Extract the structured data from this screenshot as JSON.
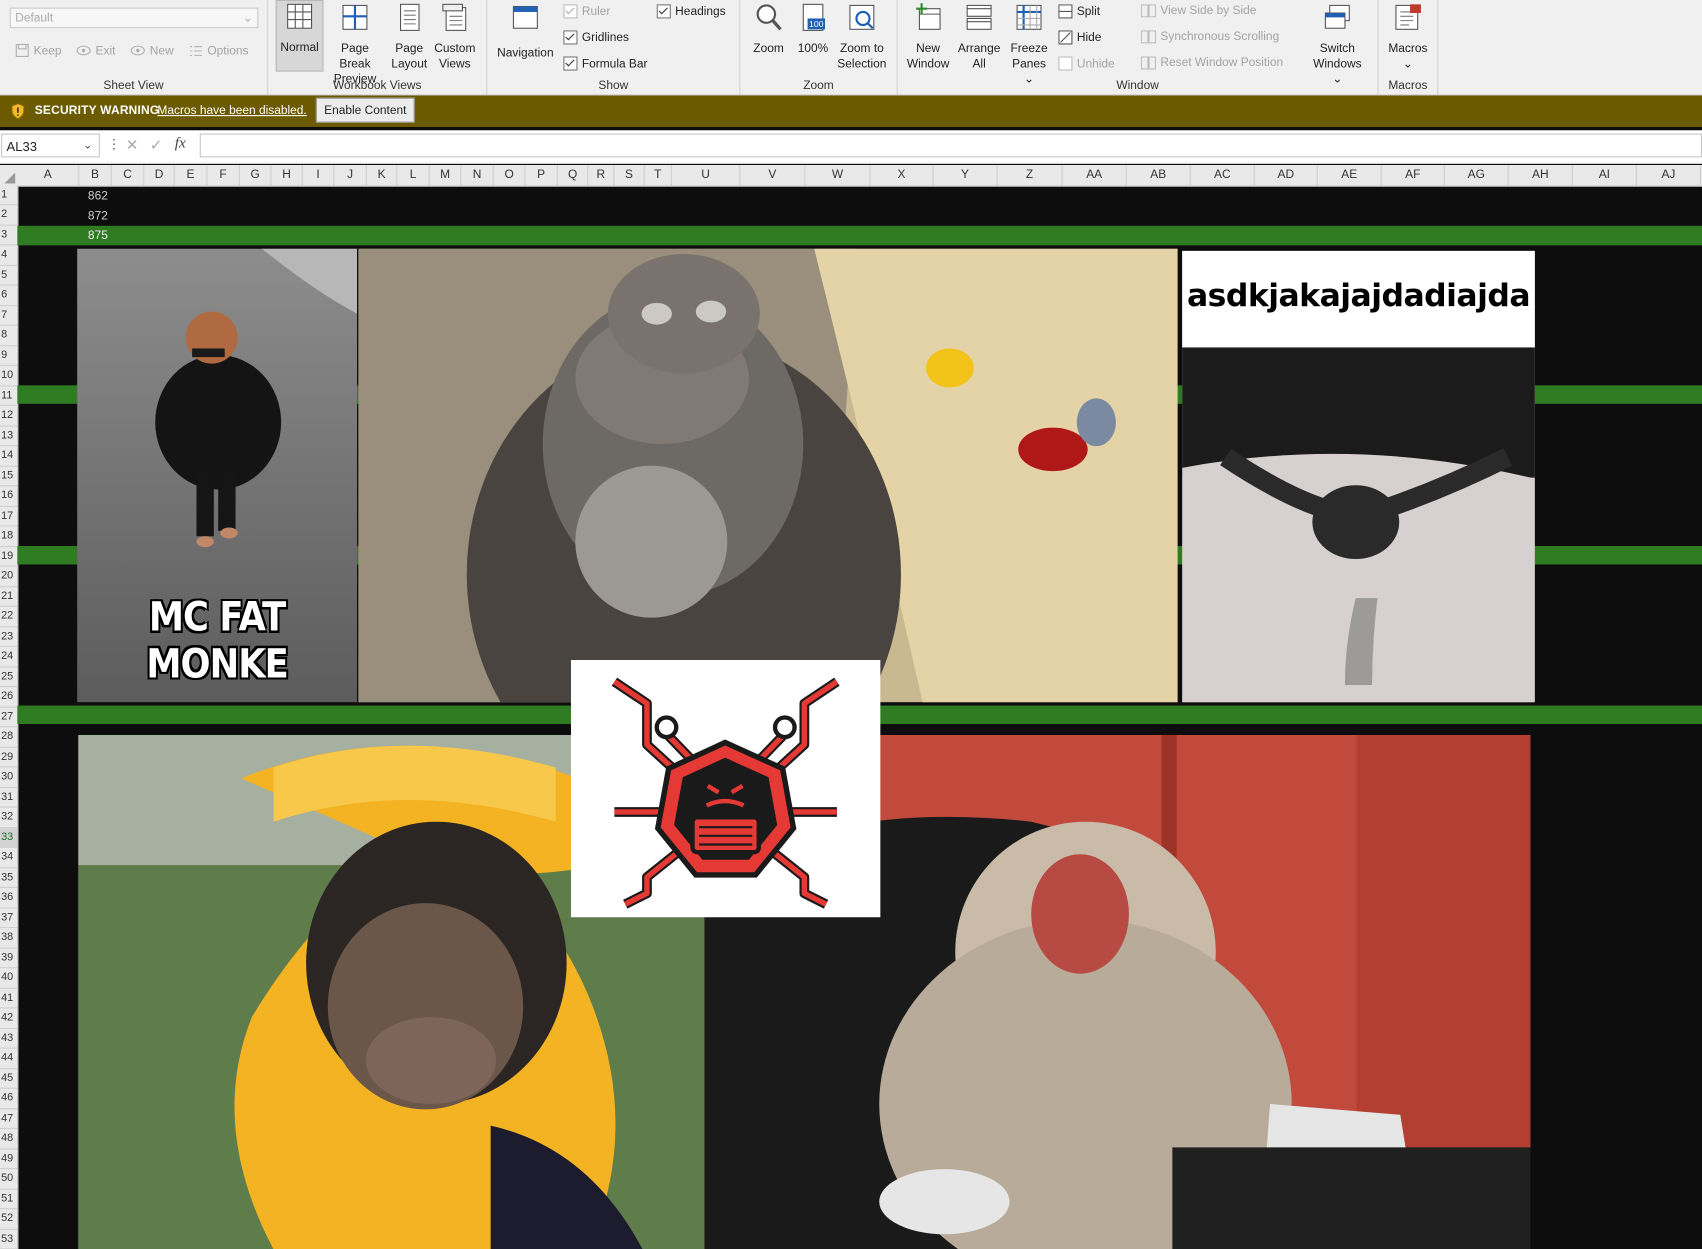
{
  "ribbon": {
    "sheet_view": {
      "select_value": "Default",
      "keep": "Keep",
      "exit": "Exit",
      "new": "New",
      "options": "Options",
      "group_label": "Sheet View"
    },
    "workbook_views": {
      "normal": "Normal",
      "page_break_1": "Page Break",
      "page_break_2": "Preview",
      "page_layout_1": "Page",
      "page_layout_2": "Layout",
      "custom_views_1": "Custom",
      "custom_views_2": "Views",
      "group_label": "Workbook Views"
    },
    "show": {
      "navigation": "Navigation",
      "ruler": "Ruler",
      "gridlines": "Gridlines",
      "formula_bar": "Formula Bar",
      "headings": "Headings",
      "group_label": "Show"
    },
    "zoom": {
      "zoom": "Zoom",
      "hundred": "100%",
      "zoom_sel_1": "Zoom to",
      "zoom_sel_2": "Selection",
      "group_label": "Zoom",
      "icon_text": "100"
    },
    "window": {
      "new_window_1": "New",
      "new_window_2": "Window",
      "arrange_1": "Arrange",
      "arrange_2": "All",
      "freeze_1": "Freeze",
      "freeze_2": "Panes",
      "split": "Split",
      "hide": "Hide",
      "unhide": "Unhide",
      "side_by_side": "View Side by Side",
      "sync_scroll": "Synchronous Scrolling",
      "reset_pos": "Reset Window Position",
      "switch_1": "Switch",
      "switch_2": "Windows",
      "group_label": "Window"
    },
    "macros": {
      "macros": "Macros",
      "group_label": "Macros"
    }
  },
  "security_bar": {
    "title": "SECURITY WARNING",
    "message": "Macros have been disabled.",
    "button": "Enable Content"
  },
  "formula_bar": {
    "name_box": "AL33",
    "dots": "⋮",
    "cancel": "✕",
    "enter": "✓",
    "fx": "fx",
    "value": ""
  },
  "columns": [
    "A",
    "B",
    "C",
    "D",
    "E",
    "F",
    "G",
    "H",
    "I",
    "J",
    "K",
    "L",
    "M",
    "N",
    "O",
    "P",
    "Q",
    "R",
    "S",
    "T",
    "U",
    "V",
    "W",
    "X",
    "Y",
    "Z",
    "AA",
    "AB",
    "AC",
    "AD",
    "AE",
    "AF",
    "AG",
    "AH",
    "AI",
    "AJ"
  ],
  "rows": [
    "1",
    "2",
    "3",
    "4",
    "5",
    "6",
    "7",
    "8",
    "9",
    "10",
    "11",
    "12",
    "13",
    "14",
    "15",
    "16",
    "17",
    "18",
    "19",
    "20",
    "21",
    "22",
    "23",
    "24",
    "25",
    "26",
    "27",
    "28",
    "29",
    "30",
    "31",
    "32",
    "33",
    "34",
    "35",
    "36",
    "37",
    "38",
    "39",
    "40",
    "41",
    "42",
    "43",
    "44",
    "45",
    "46",
    "47",
    "48",
    "49",
    "50",
    "51",
    "52",
    "53"
  ],
  "cells": {
    "b1": "862",
    "b2": "872",
    "b3": "875"
  },
  "pictures": {
    "pic1_caption": "MC FAT MONKE",
    "pic3_caption": "asdkjakajajdadiajda"
  },
  "colors": {
    "band_green": "#2f7b21",
    "security_bar": "#6b5a00",
    "sheet_background": "#0d0d0d"
  }
}
